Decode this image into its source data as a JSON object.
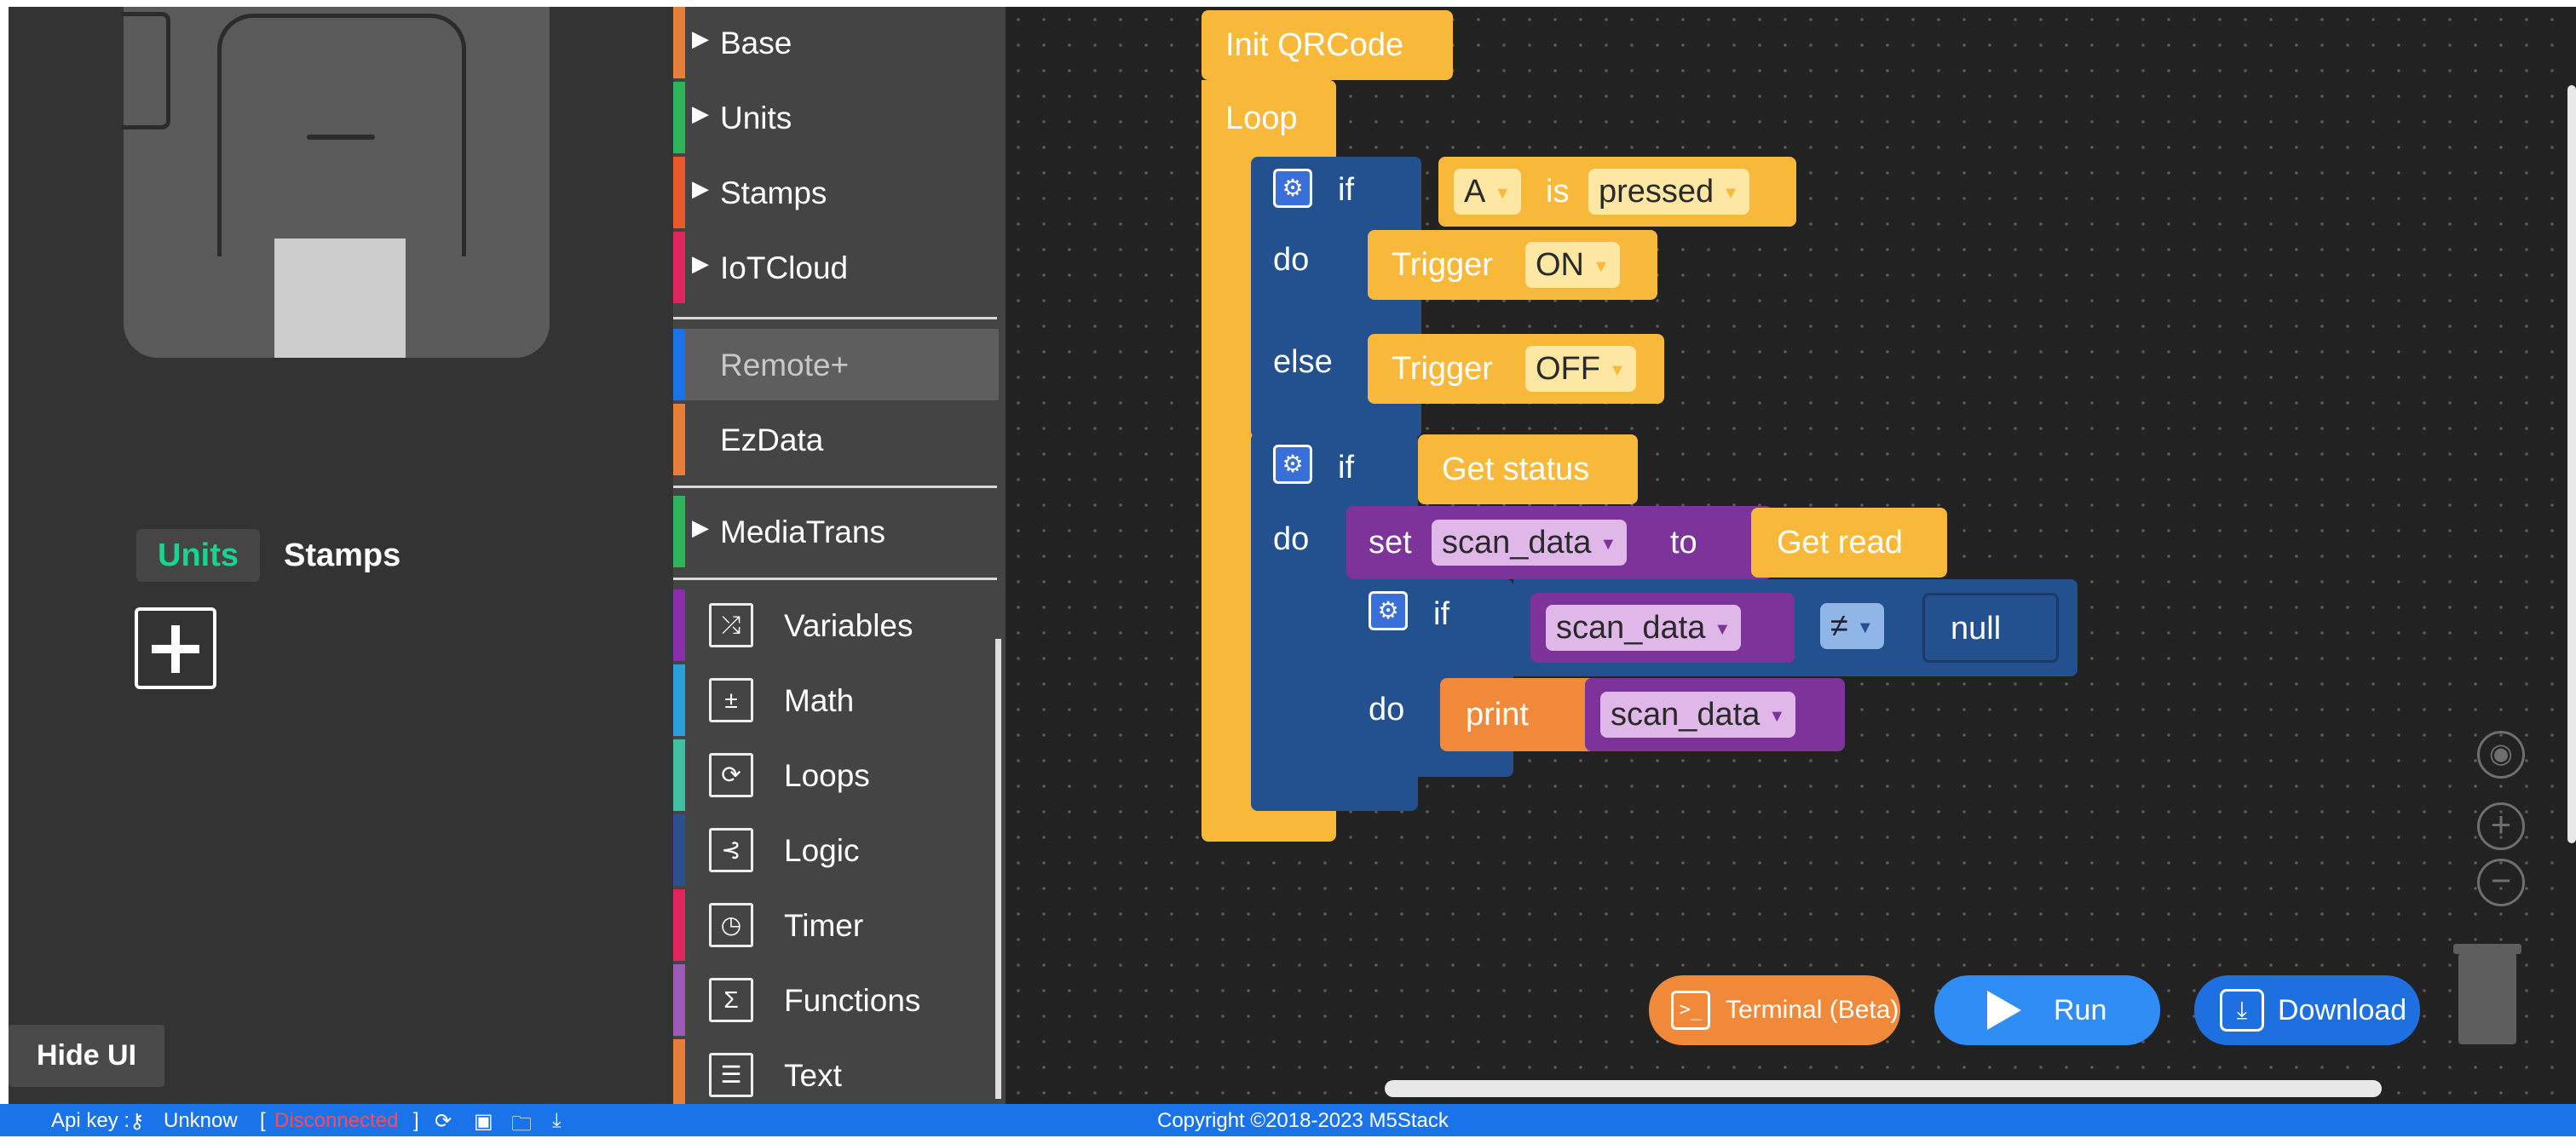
{
  "left_panel": {
    "units_tab": "Units",
    "stamps_tab": "Stamps",
    "hide_ui": "Hide UI"
  },
  "toolbox": {
    "collapsible": [
      {
        "label": "Base",
        "color": "#e67e3a"
      },
      {
        "label": "Units",
        "color": "#2fb35a"
      },
      {
        "label": "Stamps",
        "color": "#e85a2c"
      },
      {
        "label": "IoTCloud",
        "color": "#e0245e"
      }
    ],
    "remote": {
      "label": "Remote+",
      "color": "#1a73e8"
    },
    "ezdata": {
      "label": "EzData",
      "color": "#e67e3a"
    },
    "mediatrans": {
      "label": "MediaTrans",
      "color": "#2fb35a"
    },
    "core": [
      {
        "label": "Variables",
        "color": "#8a2da8",
        "icon": "shuffle-icon",
        "glyph": "⤮"
      },
      {
        "label": "Math",
        "color": "#2a9fd8",
        "icon": "calculator-icon",
        "glyph": "±"
      },
      {
        "label": "Loops",
        "color": "#40c0a0",
        "icon": "loop-icon",
        "glyph": "⟳"
      },
      {
        "label": "Logic",
        "color": "#2c4f8f",
        "icon": "branch-icon",
        "glyph": "⊰"
      },
      {
        "label": "Timer",
        "color": "#e0245e",
        "icon": "timer-icon",
        "glyph": "◷"
      },
      {
        "label": "Functions",
        "color": "#9c59b6",
        "icon": "sigma-icon",
        "glyph": "Σ"
      },
      {
        "label": "Text",
        "color": "#e67e3a",
        "icon": "text-card-icon",
        "glyph": "☰"
      }
    ]
  },
  "blocks": {
    "init": "Init QRCode",
    "loop": "Loop",
    "if1": {
      "if": "if",
      "button": "A",
      "is": "is",
      "state": "pressed",
      "do": "do",
      "trigger_on": "Trigger",
      "on_value": "ON",
      "else": "else",
      "trigger_off": "Trigger",
      "off_value": "OFF"
    },
    "if2": {
      "if": "if",
      "get_status": "Get status",
      "do": "do",
      "set": "set",
      "var": "scan_data",
      "to": "to",
      "get_read": "Get read"
    },
    "if3": {
      "if": "if",
      "var": "scan_data",
      "op": "≠",
      "null": "null",
      "do": "do",
      "print": "print",
      "print_var": "scan_data"
    }
  },
  "actions": {
    "terminal": "Terminal (Beta)",
    "run": "Run",
    "download": "Download"
  },
  "status": {
    "api_key_label": "Api key :",
    "api_key_value": "Unknow",
    "bracket_open": "[",
    "connection": "Disconnected",
    "bracket_close": "]",
    "copyright": "Copyright ©2018-2023 M5Stack"
  }
}
